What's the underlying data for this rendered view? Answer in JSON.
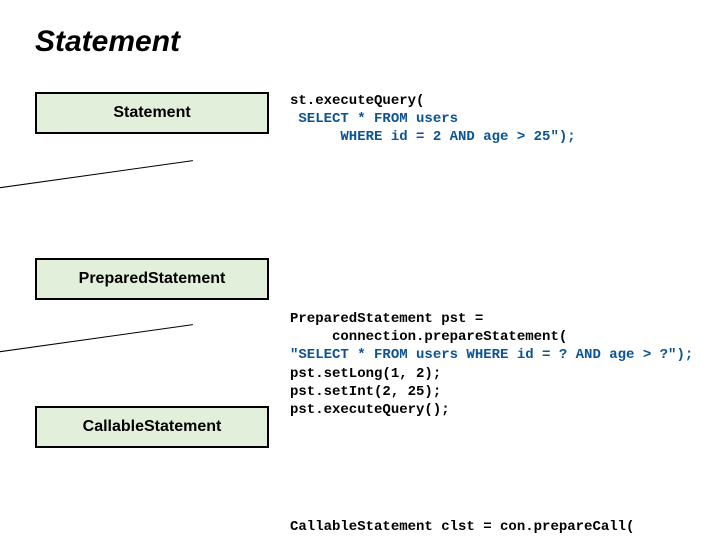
{
  "title": "Statement",
  "boxes": {
    "statement": "Statement",
    "prepared": "PreparedStatement",
    "callable": "CallableStatement"
  },
  "code_statement": {
    "l1": "st.executeQuery(",
    "l2": " SELECT * FROM users",
    "l3": "      WHERE id = 2 AND age > 25\");"
  },
  "code_prepared": {
    "l1": "PreparedStatement pst =",
    "l2": "     connection.prepareStatement(",
    "l3": "\"SELECT * FROM users WHERE id = ? AND age > ?\");",
    "l4": "pst.setLong(1, 2);",
    "l5": "pst.setInt(2, 25);",
    "l6": "pst.executeQuery();"
  },
  "code_callable": {
    "l1": "CallableStatement clst = con.prepareCall("
  }
}
